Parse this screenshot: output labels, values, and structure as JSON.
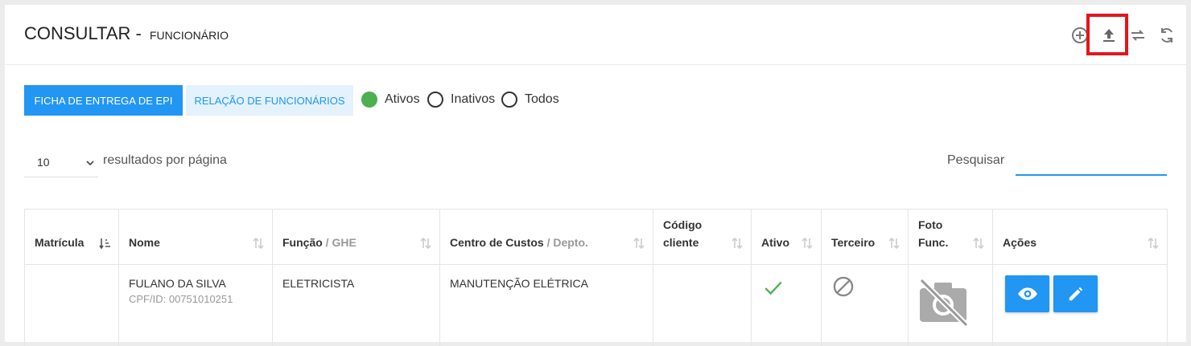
{
  "header": {
    "title": "CONSULTAR - ",
    "subtitle": "FUNCIONÁRIO",
    "tools": [
      {
        "name": "add-icon"
      },
      {
        "name": "upload-icon"
      },
      {
        "name": "swap-icon"
      },
      {
        "name": "refresh-icon"
      }
    ],
    "highlight_color": "#e2161e"
  },
  "toolbar": {
    "epi_button": "FICHA DE ENTREGA DE EPI",
    "relacao_button": "RELAÇÃO DE FUNCIONÁRIOS",
    "filters": [
      {
        "label": "Ativos",
        "selected": true
      },
      {
        "label": "Inativos",
        "selected": false
      },
      {
        "label": "Todos",
        "selected": false
      }
    ]
  },
  "length": {
    "value": "10",
    "label": "resultados por página"
  },
  "search": {
    "label": "Pesquisar",
    "value": ""
  },
  "table": {
    "columns": [
      {
        "label": "Matrícula",
        "muted": ""
      },
      {
        "label": "Nome",
        "muted": ""
      },
      {
        "label": "Função",
        "muted": " / GHE"
      },
      {
        "label": "Centro de Custos",
        "muted": " / Depto."
      },
      {
        "label": "Código",
        "line2": "cliente"
      },
      {
        "label": "Ativo",
        "muted": ""
      },
      {
        "label": "Terceiro",
        "muted": ""
      },
      {
        "label": "Foto",
        "line2": "Func."
      },
      {
        "label": "Ações",
        "muted": ""
      }
    ],
    "rows": [
      {
        "matricula": "",
        "nome": "FULANO DA SILVA",
        "cpf": "CPF/ID: 00751010251",
        "funcao": "ELETRICISTA",
        "centro": "MANUTENÇÃO ELÉTRICA",
        "codigo": "",
        "ativo": true,
        "terceiro": false
      }
    ]
  },
  "colors": {
    "primary": "#2196f3",
    "primary_light": "#e3f2fd",
    "active_green": "#4caf50"
  }
}
